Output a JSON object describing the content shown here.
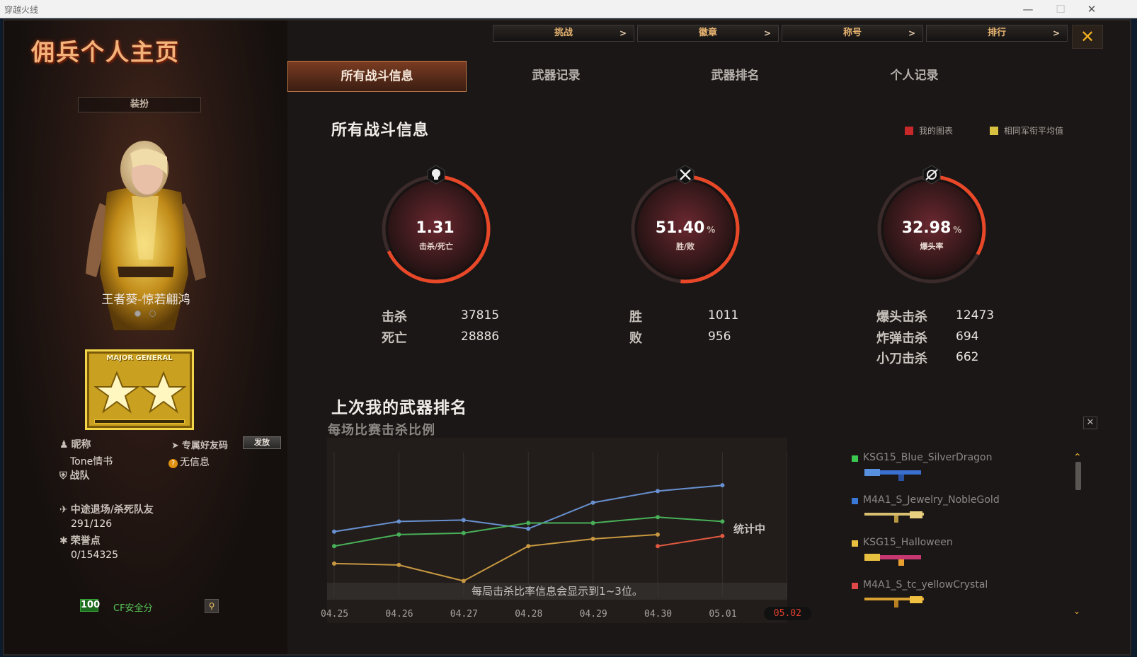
{
  "window": {
    "title": "穿越火线",
    "minimize": "—",
    "maximize": "☐",
    "close": "✕"
  },
  "page": {
    "title": "佣兵个人主页"
  },
  "topnav": [
    {
      "label": "挑战",
      "chev": ">"
    },
    {
      "label": "徽章",
      "chev": ">"
    },
    {
      "label": "称号",
      "chev": ">"
    },
    {
      "label": "排行",
      "chev": ">"
    }
  ],
  "close_label": "✕",
  "tabs": [
    {
      "label": "所有战斗信息",
      "active": true
    },
    {
      "label": "武器记录",
      "active": false
    },
    {
      "label": "武器排名",
      "active": false
    },
    {
      "label": "个人记录",
      "active": false
    }
  ],
  "profile": {
    "outfit_label": "装扮",
    "character_name": "王者葵-惊若翩鸿",
    "rank_text": "MAJOR GENERAL",
    "nickname_label": "昵称",
    "nickname": "Tone情书",
    "friend_code_label": "专属好友码",
    "send_label": "发放",
    "friend_code_value": "无信息",
    "team_label": "战队",
    "quit_label": "中途退场/杀死队友",
    "quit_value": "291/126",
    "honor_label": "荣誉点",
    "honor_value": "0/154325",
    "safety_score": "100",
    "safety_label": "CF安全分"
  },
  "battle": {
    "title": "所有战斗信息",
    "legend": [
      {
        "label": "我的图表",
        "color": "#c8282a"
      },
      {
        "label": "相同军衔平均值",
        "color": "#d8c040"
      }
    ],
    "gauges": [
      {
        "value": "1.31",
        "unit": "",
        "label": "击杀/死亡",
        "icon": "skull-icon",
        "fraction": 0.68
      },
      {
        "value": "51.40",
        "unit": "%",
        "label": "胜/败",
        "icon": "crossed-guns-icon",
        "fraction": 0.514
      },
      {
        "value": "32.98",
        "unit": "%",
        "label": "爆头率",
        "icon": "headshot-icon",
        "fraction": 0.33
      }
    ],
    "stats": [
      {
        "label": "击杀",
        "value": "37815"
      },
      {
        "label": "死亡",
        "value": "28886"
      },
      {
        "label": "胜",
        "value": "1011"
      },
      {
        "label": "败",
        "value": "956"
      },
      {
        "label": "爆头击杀",
        "value": "12473"
      },
      {
        "label": "炸弹击杀",
        "value": "694"
      },
      {
        "label": "小刀击杀",
        "value": "662"
      }
    ]
  },
  "weapon_rank": {
    "title": "上次我的武器排名",
    "subtitle": "每场比赛击杀比例",
    "note": "每局击杀比率信息会显示到1~3位。",
    "counting": "统计中",
    "weapons": [
      {
        "name": "KSG15_Blue_SilverDragon",
        "color": "#3ac850"
      },
      {
        "name": "M4A1_S_Jewelry_NobleGold",
        "color": "#3a78d8"
      },
      {
        "name": "KSG15_Halloween",
        "color": "#e8c040"
      },
      {
        "name": "M4A1_S_tc_yellowCrystal",
        "color": "#e04848"
      }
    ]
  },
  "chart_data": {
    "type": "line",
    "categories": [
      "04.25",
      "04.26",
      "04.27",
      "04.28",
      "04.29",
      "04.30",
      "05.01",
      "05.02"
    ],
    "active_category": "05.02",
    "ylim": [
      0,
      100
    ],
    "grid": true,
    "series": [
      {
        "color": "#6890d0",
        "values": [
          45,
          52,
          53,
          47,
          65,
          73,
          77,
          null
        ]
      },
      {
        "color": "#48b058",
        "values": [
          35,
          43,
          44,
          51,
          51,
          55,
          52,
          null
        ]
      },
      {
        "color": "#c89840",
        "values": [
          23,
          22,
          11,
          35,
          40,
          43,
          null,
          null
        ]
      },
      {
        "color": "#e05840",
        "values": [
          null,
          null,
          null,
          null,
          null,
          35,
          42,
          null
        ]
      }
    ]
  }
}
